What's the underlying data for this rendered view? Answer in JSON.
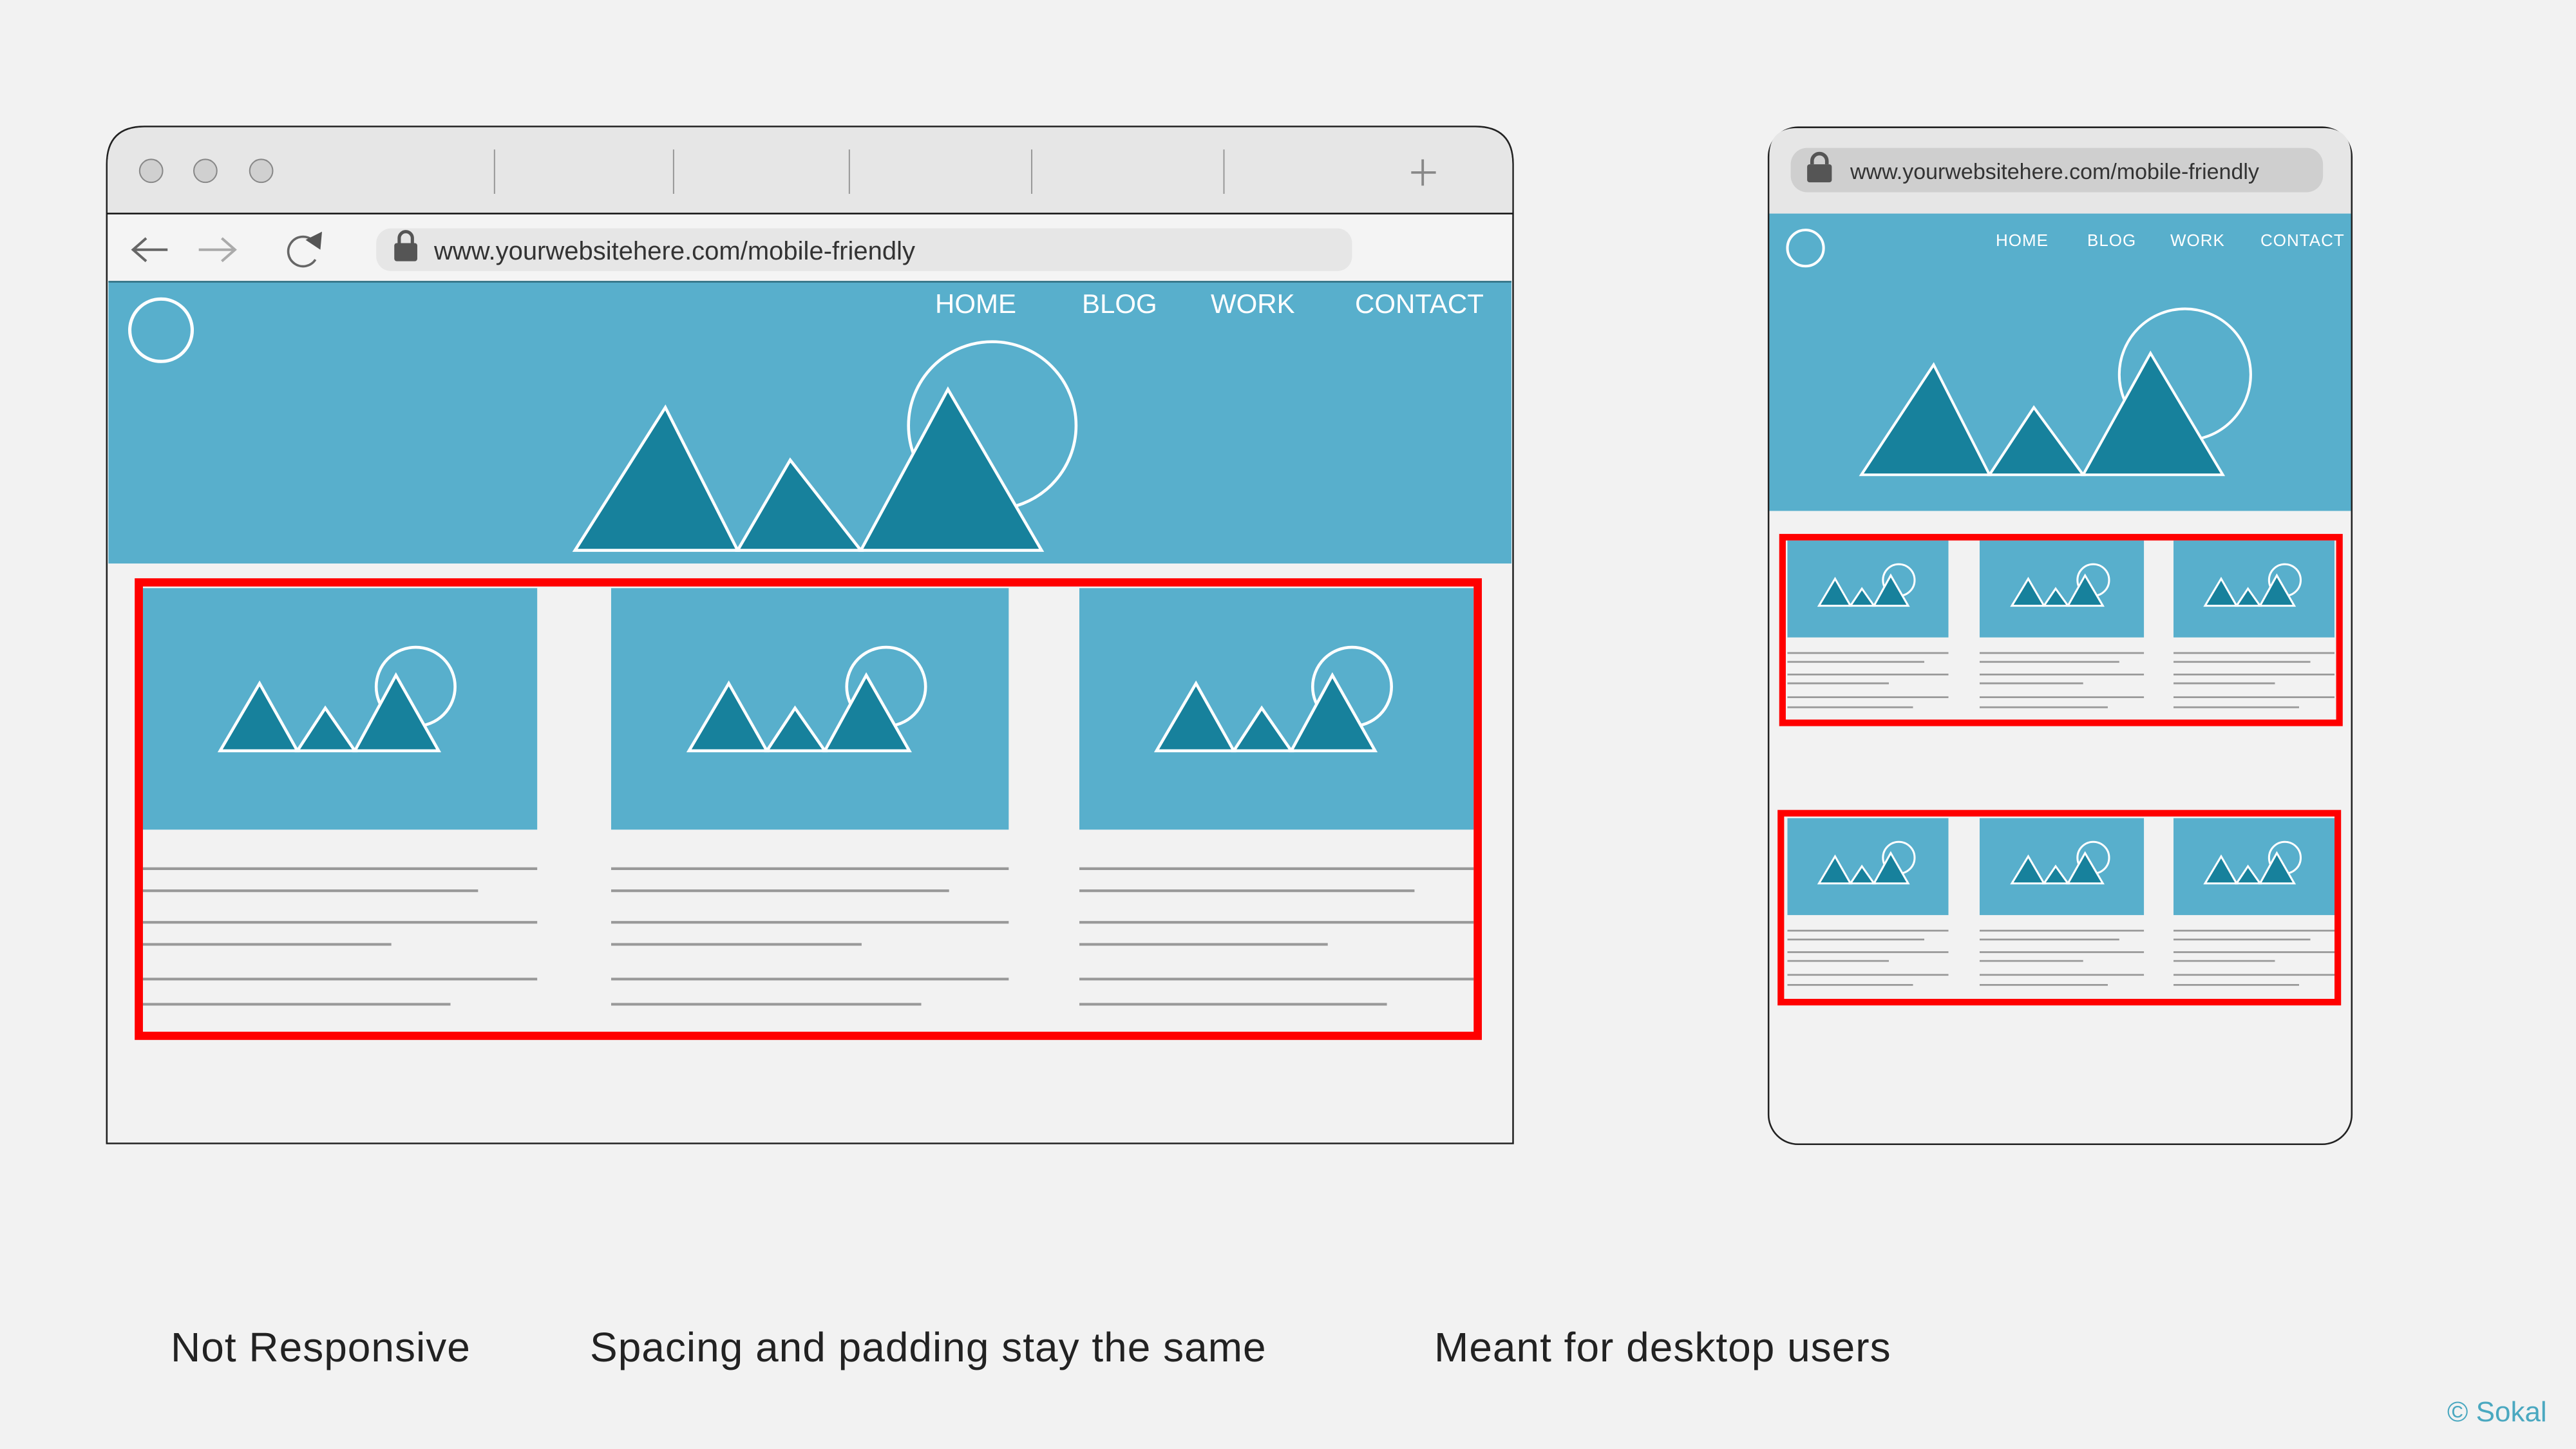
{
  "colors": {
    "hero": "#58afcc",
    "mountain": "#17819c",
    "highlight": "#ff0000",
    "background": "#f2f2f2",
    "chrome": "#e6e6e6",
    "credit": "#4aa8c0"
  },
  "desktop": {
    "url": "www.yourwebsitehere.com/mobile-friendly",
    "nav": [
      "HOME",
      "BLOG",
      "WORK",
      "CONTACT"
    ],
    "icons": [
      "window-dot-icon",
      "back-arrow-icon",
      "forward-arrow-icon",
      "reload-icon",
      "lock-icon",
      "new-tab-plus-icon"
    ]
  },
  "mobile": {
    "url": "www.yourwebsitehere.com/mobile-friendly",
    "nav": [
      "HOME",
      "BLOG",
      "WORK",
      "CONTACT"
    ]
  },
  "captions": [
    "Not Responsive",
    "Spacing and padding stay the same",
    "Meant for desktop users"
  ],
  "credit": "© Sokal"
}
